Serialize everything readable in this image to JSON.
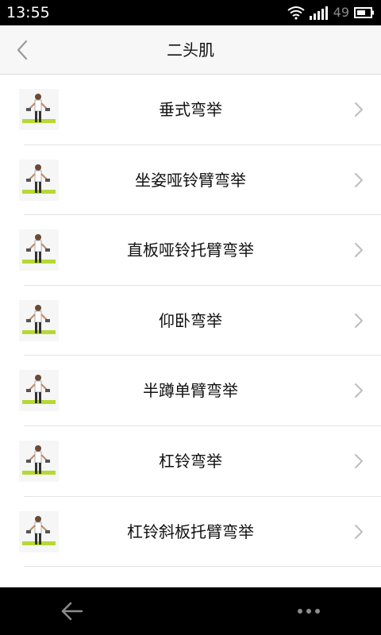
{
  "status_bar": {
    "time": "13:55",
    "battery_level": "49",
    "icons": [
      "wifi-icon",
      "signal-icon",
      "battery-icon"
    ]
  },
  "header": {
    "title": "二头肌",
    "back_icon": "chevron-left-icon"
  },
  "exercises": [
    {
      "label": "垂式弯举",
      "thumbnail": "exercise-thumbnail"
    },
    {
      "label": "坐姿哑铃臂弯举",
      "thumbnail": "exercise-thumbnail"
    },
    {
      "label": "直板哑铃托臂弯举",
      "thumbnail": "exercise-thumbnail"
    },
    {
      "label": "仰卧弯举",
      "thumbnail": "exercise-thumbnail"
    },
    {
      "label": "半蹲单臂弯举",
      "thumbnail": "exercise-thumbnail"
    },
    {
      "label": "杠铃弯举",
      "thumbnail": "exercise-thumbnail"
    },
    {
      "label": "杠铃斜板托臂弯举",
      "thumbnail": "exercise-thumbnail"
    }
  ],
  "nav_bar": {
    "icons": [
      "back-arrow-icon",
      "more-dots-icon"
    ]
  },
  "colors": {
    "status_bar_bg": "#000000",
    "header_bg": "#f7f7f7",
    "divider": "#e3e3e3",
    "chevron": "#bdbdbd",
    "text": "#111111",
    "thumb_accent": "#b6d834"
  }
}
